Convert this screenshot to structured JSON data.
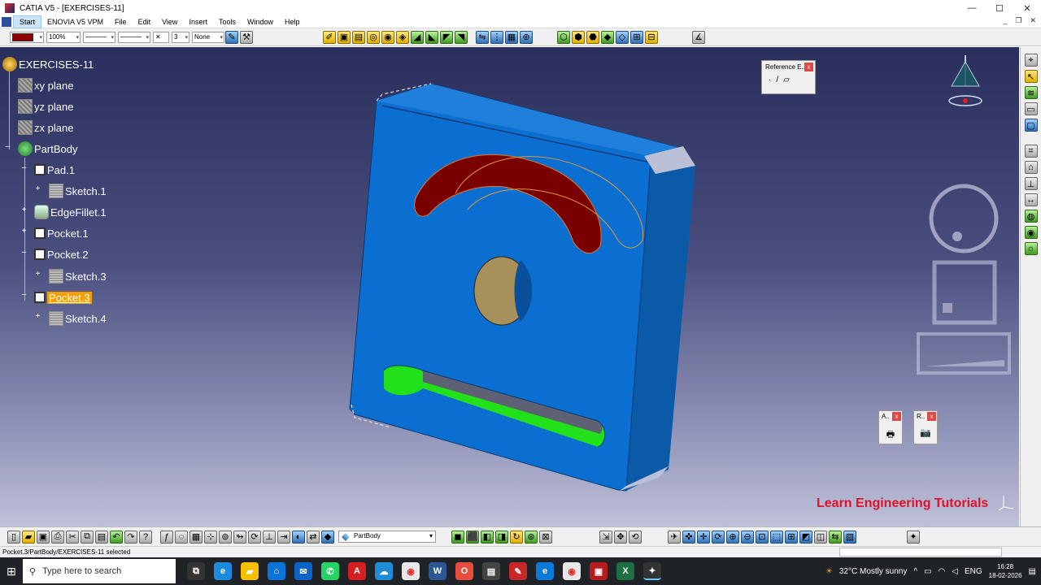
{
  "window": {
    "title": "CATIA V5 - [EXERCISES-11]",
    "controls": {
      "minimize": "—",
      "maximize": "☐",
      "close": "✕"
    }
  },
  "menu": {
    "items": [
      "Start",
      "ENOVIA V5 VPM",
      "File",
      "Edit",
      "View",
      "Insert",
      "Tools",
      "Window",
      "Help"
    ],
    "mdi": {
      "minimize": "_",
      "restore": "❐",
      "close": "✕"
    }
  },
  "toolbar": {
    "zoom": "100%",
    "line_weight": "3",
    "layer": "None",
    "accent_color": "#8b0000"
  },
  "tree": {
    "root": "EXERCISES-11",
    "planes": [
      "xy plane",
      "yz plane",
      "zx plane"
    ],
    "body": "PartBody",
    "features": [
      {
        "label": "Pad.1",
        "child": "Sketch.1"
      },
      {
        "label": "EdgeFillet.1"
      },
      {
        "label": "Pocket.1"
      },
      {
        "label": "Pocket.2",
        "child": "Sketch.3"
      },
      {
        "label": "Pocket.3",
        "child": "Sketch.4",
        "selected": true
      }
    ]
  },
  "ref_panel": {
    "title": "Reference E...",
    "close": "x",
    "tools": [
      "·",
      "/",
      "▱"
    ]
  },
  "mini_panels": [
    {
      "title": "A..",
      "close": "x",
      "icon": "🖶"
    },
    {
      "title": "R..",
      "close": "x",
      "icon": "📷"
    }
  ],
  "watermark": "Learn Engineering Tutorials",
  "bottom_toolbar": {
    "body_select": "PartBody"
  },
  "status": {
    "text": "Pocket.3/PartBody/EXERCISES-11 selected"
  },
  "taskbar": {
    "search_placeholder": "Type here to search",
    "weather": "32°C  Mostly sunny",
    "language": "ENG",
    "time": "16:28",
    "date": "18-02-2026"
  },
  "colors": {
    "part_face": "#0a6fd1",
    "part_side": "#0b5aa8",
    "slot_red": "#7a0000",
    "slot_green": "#22e01a",
    "hole_tan": "#a8905a",
    "selection": "#f5a000"
  }
}
